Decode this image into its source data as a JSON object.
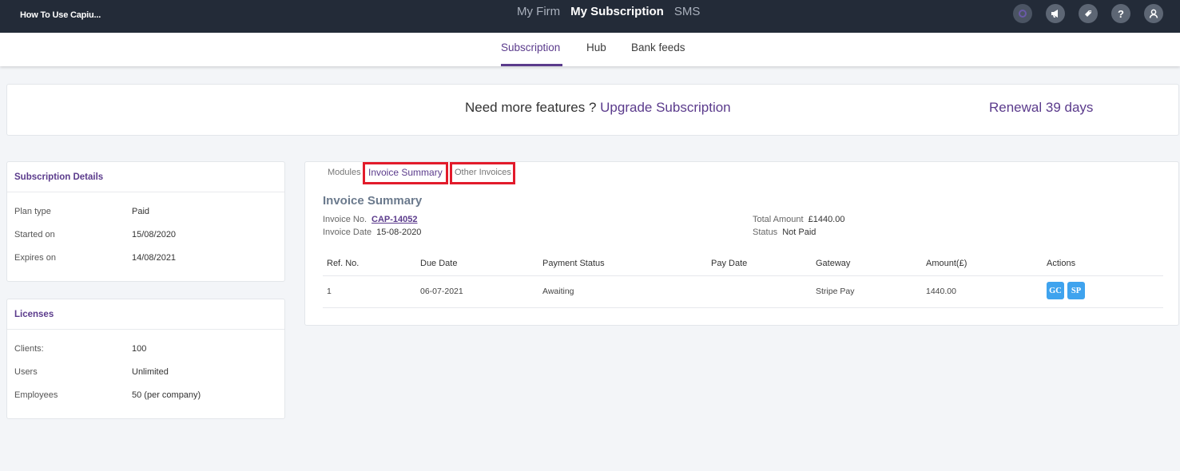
{
  "app": {
    "title": "How To Use Capiu..."
  },
  "topnav": {
    "items": [
      "My Firm",
      "My Subscription",
      "SMS"
    ],
    "active": "My Subscription"
  },
  "topicons": [
    "status-dot-icon",
    "megaphone-icon",
    "tag-icon",
    "help-icon",
    "user-icon"
  ],
  "subnav": {
    "tabs": [
      "Subscription",
      "Hub",
      "Bank feeds"
    ],
    "active": "Subscription"
  },
  "banner": {
    "question": "Need more features ? ",
    "upgrade_link": "Upgrade Subscription",
    "renewal": "Renewal 39 days"
  },
  "subscription_details": {
    "heading": "Subscription Details",
    "rows": [
      {
        "label": "Plan type",
        "value": "Paid"
      },
      {
        "label": "Started on",
        "value": "15/08/2020"
      },
      {
        "label": "Expires on",
        "value": "14/08/2021"
      }
    ]
  },
  "licenses": {
    "heading": "Licenses",
    "rows": [
      {
        "label": "Clients:",
        "value": "100"
      },
      {
        "label": "Users",
        "value": "Unlimited"
      },
      {
        "label": "Employees",
        "value": "50 (per company)"
      }
    ]
  },
  "invoice_tabs": {
    "items": [
      "Modules",
      "Invoice Summary",
      "Other Invoices"
    ],
    "active": "Invoice Summary"
  },
  "invoice": {
    "title": "Invoice Summary",
    "invoice_no_label": "Invoice No.",
    "invoice_no": "CAP-14052",
    "invoice_date_label": "Invoice Date",
    "invoice_date": "15-08-2020",
    "total_label": "Total Amount",
    "total": "£1440.00",
    "status_label": "Status",
    "status": "Not Paid"
  },
  "table": {
    "columns": [
      "Ref. No.",
      "Due Date",
      "Payment Status",
      "Pay Date",
      "Gateway",
      "Amount(£)",
      "Actions"
    ],
    "rows": [
      {
        "ref": "1",
        "due": "06-07-2021",
        "payment_status": "Awaiting",
        "pay_date": "",
        "gateway": "Stripe Pay",
        "amount": "1440.00",
        "actions": [
          "GC",
          "SP"
        ]
      }
    ]
  },
  "colors": {
    "topbar": "#232b38",
    "accent": "#5b3b8c",
    "highlight": "#e21b2b",
    "action_button": "#3fa3ee"
  }
}
